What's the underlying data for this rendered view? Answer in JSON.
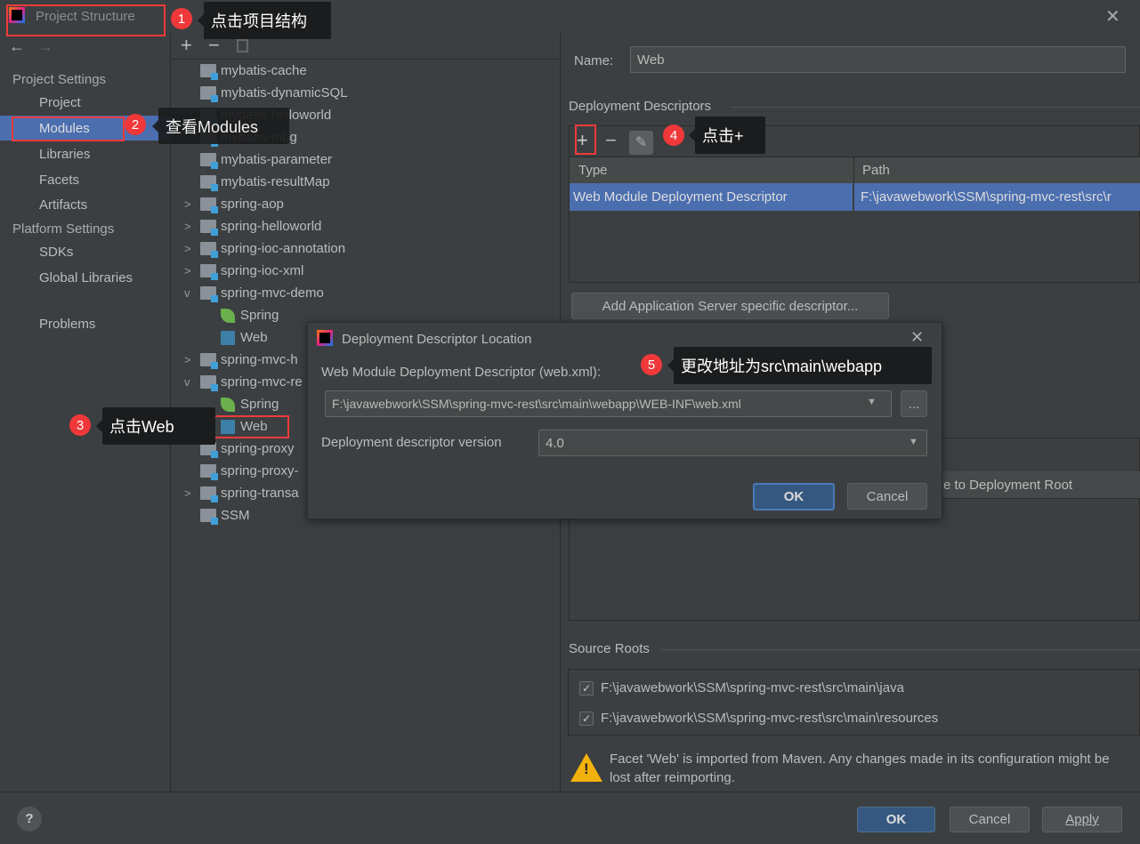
{
  "window": {
    "title": "Project Structure"
  },
  "sidebar": {
    "project_settings": "Project Settings",
    "items": [
      "Project",
      "Modules",
      "Libraries",
      "Facets",
      "Artifacts"
    ],
    "platform_settings": "Platform Settings",
    "platform_items": [
      "SDKs",
      "Global Libraries"
    ],
    "problems": "Problems"
  },
  "tree": {
    "toolbar": {
      "add": "+",
      "remove": "−"
    },
    "rows": [
      "mybatis-cache",
      "mybatis-dynamicSQL",
      "mybatis-helloworld",
      "mybatis-mbg",
      "mybatis-parameter",
      "mybatis-resultMap",
      "spring-aop",
      "spring-helloworld",
      "spring-ioc-annotation",
      "spring-ioc-xml",
      "spring-mvc-demo",
      "Spring",
      "Web",
      "spring-mvc-h",
      "spring-mvc-re",
      "Spring",
      "Web",
      "spring-proxy",
      "spring-proxy-",
      "spring-transa",
      "SSM"
    ]
  },
  "right": {
    "name_label": "Name:",
    "name_value": "Web",
    "deployment_descriptors": "Deployment Descriptors",
    "table_headers": [
      "Type",
      "Path"
    ],
    "table_row": [
      "Web Module Deployment Descriptor",
      "F:\\javawebwork\\SSM\\spring-mvc-rest\\src\\r"
    ],
    "add_server_btn": "Add Application Server specific descriptor...",
    "deploy_root_btn": "e to Deployment Root",
    "source_roots": "Source Roots",
    "roots": [
      "F:\\javawebwork\\SSM\\spring-mvc-rest\\src\\main\\java",
      "F:\\javawebwork\\SSM\\spring-mvc-rest\\src\\main\\resources"
    ],
    "warning": "Facet 'Web' is imported from Maven. Any changes made in its configuration might be lost after reimporting."
  },
  "dialog": {
    "title": "Deployment Descriptor Location",
    "label": "Web Module Deployment Descriptor (web.xml):",
    "path": "F:\\javawebwork\\SSM\\spring-mvc-rest\\src\\main\\webapp\\WEB-INF\\web.xml",
    "browse": "...",
    "version_label": "Deployment descriptor version",
    "version": "4.0",
    "ok": "OK",
    "cancel": "Cancel"
  },
  "footer": {
    "help": "?",
    "ok": "OK",
    "cancel": "Cancel",
    "apply": "Apply"
  },
  "annotations": [
    {
      "n": "1",
      "text": "点击项目结构"
    },
    {
      "n": "2",
      "text": "查看Modules"
    },
    {
      "n": "3",
      "text": "点击Web"
    },
    {
      "n": "4",
      "text": "点击+"
    },
    {
      "n": "5",
      "text": "更改地址为src\\main\\webapp"
    }
  ],
  "colors": {
    "accent": "#4b6eaf",
    "annotation": "#f03a3a",
    "primary_button": "#365880"
  }
}
